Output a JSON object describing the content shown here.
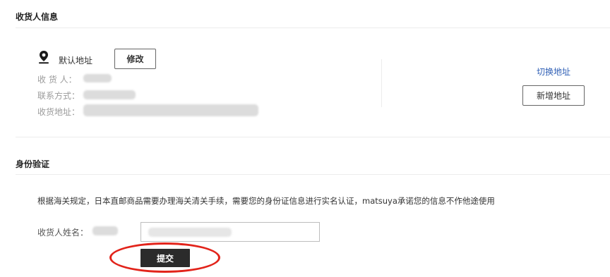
{
  "consignee_section": {
    "title": "收货人信息",
    "default_address_label": "默认地址",
    "edit_label": "修改",
    "fields": [
      {
        "label": "收  货  人："
      },
      {
        "label": "联系方式："
      },
      {
        "label": "收货地址："
      }
    ],
    "switch_address_label": "切换地址",
    "add_address_label": "新增地址"
  },
  "identity_section": {
    "title": "身份验证",
    "notice": "根据海关规定，日本直邮商品需要办理海关清关手续，需要您的身份证信息进行实名认证，matsuya承诺您的信息不作他途使用",
    "name_label": "收货人姓名：",
    "submit_label": "提交"
  },
  "colors": {
    "link": "#2f5fb5",
    "submit_bg": "#2b2b2b",
    "annotation": "#e2231a"
  },
  "icons": {
    "location": "location-pin-icon"
  }
}
